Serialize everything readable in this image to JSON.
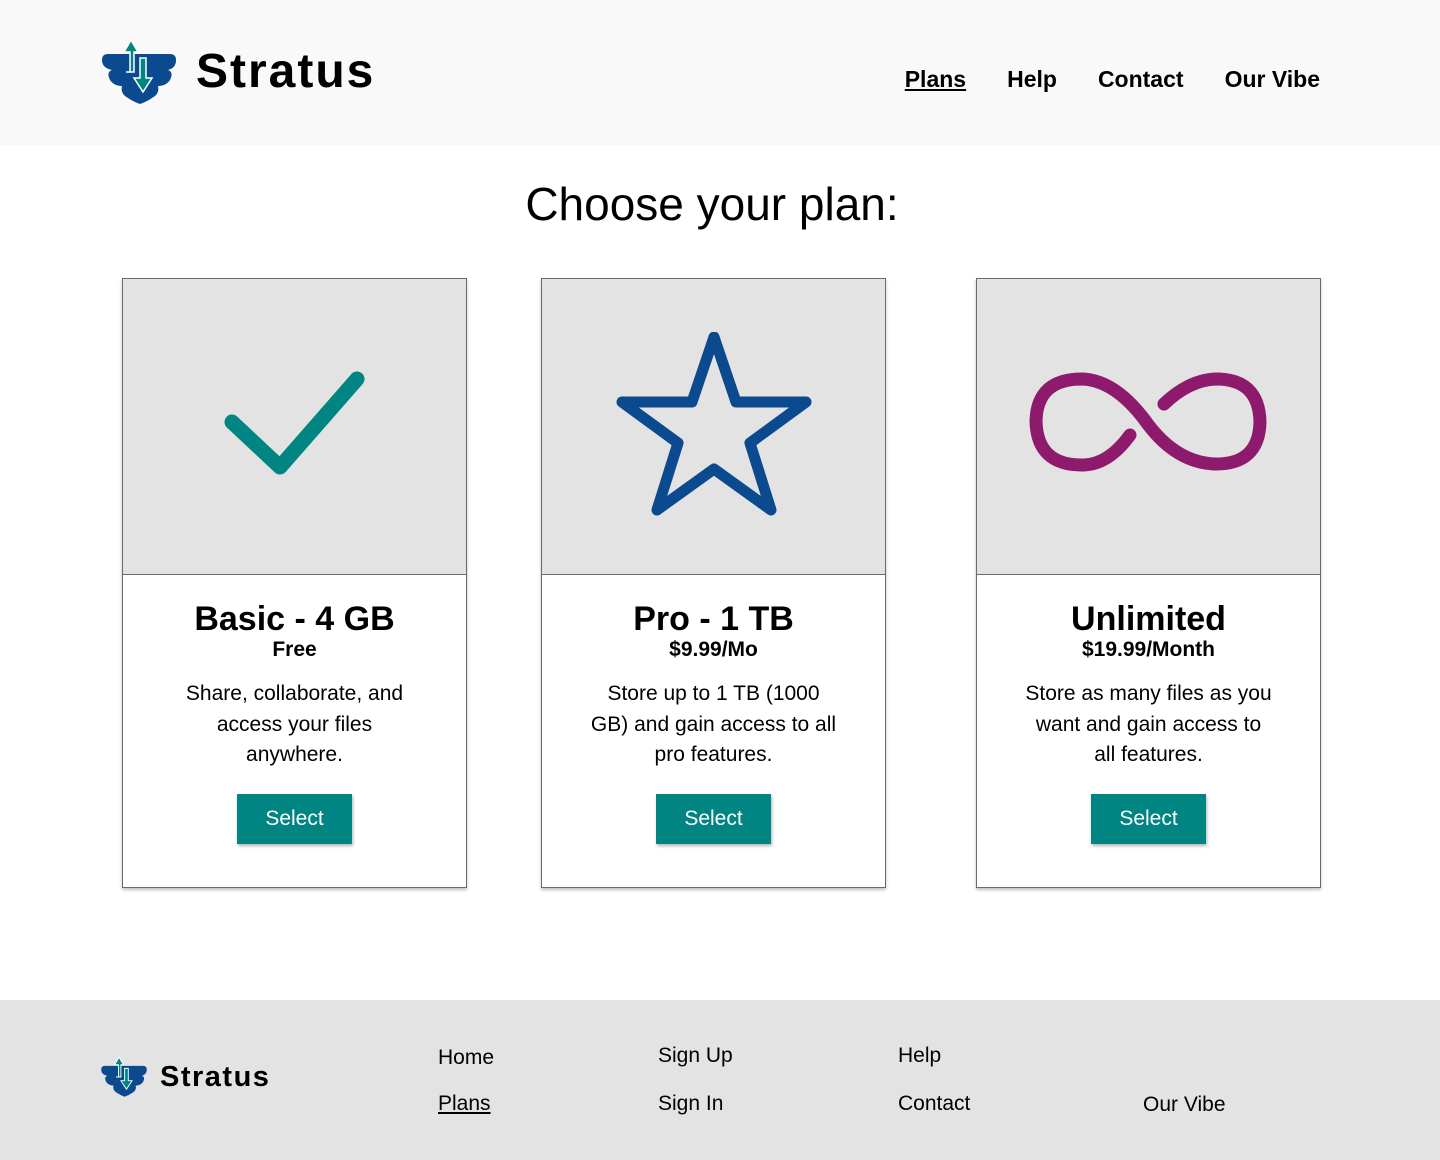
{
  "brand": {
    "name": "Stratus",
    "colors": {
      "teal": "#008582",
      "navy": "#0b4a8f",
      "magenta": "#8e1a6e"
    }
  },
  "nav": {
    "items": [
      {
        "label": "Plans",
        "active": true
      },
      {
        "label": "Help"
      },
      {
        "label": "Contact"
      },
      {
        "label": "Our Vibe"
      }
    ]
  },
  "main": {
    "title": "Choose your plan:",
    "plans": [
      {
        "icon": "checkmark-icon",
        "name": "Basic - 4 GB",
        "price": "Free",
        "description": "Share, collaborate, and access your files anywhere.",
        "button": "Select"
      },
      {
        "icon": "star-icon",
        "name": "Pro - 1 TB",
        "price": "$9.99/Mo",
        "description": "Store up to 1 TB (1000 GB) and gain access to all pro features.",
        "button": "Select"
      },
      {
        "icon": "infinity-icon",
        "name": "Unlimited",
        "price": "$19.99/Month",
        "description": "Store as many files as you want and gain access to all features.",
        "button": "Select"
      }
    ]
  },
  "footer": {
    "brand": "Stratus",
    "links": {
      "home": "Home",
      "plans": "Plans",
      "sign_up": "Sign Up",
      "sign_in": "Sign In",
      "help": "Help",
      "contact": "Contact",
      "our_vibe": "Our Vibe"
    }
  }
}
